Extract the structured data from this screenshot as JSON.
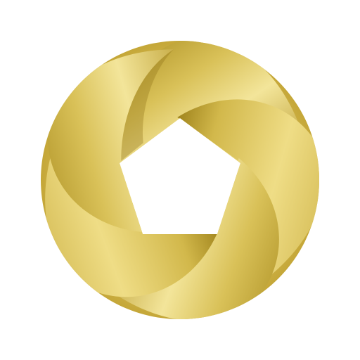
{
  "logo": {
    "icon": "golden-aperture-ring-icon",
    "shape": "ring of five overlapping metallic blades forming a pentagonal opening",
    "blade_count": 5,
    "colors": {
      "background": "#ffffff",
      "gold_light": "#f3e59a",
      "gold_mid": "#d9c158",
      "gold_dark": "#a98c1f",
      "gold_shadow": "#8f7416"
    }
  }
}
